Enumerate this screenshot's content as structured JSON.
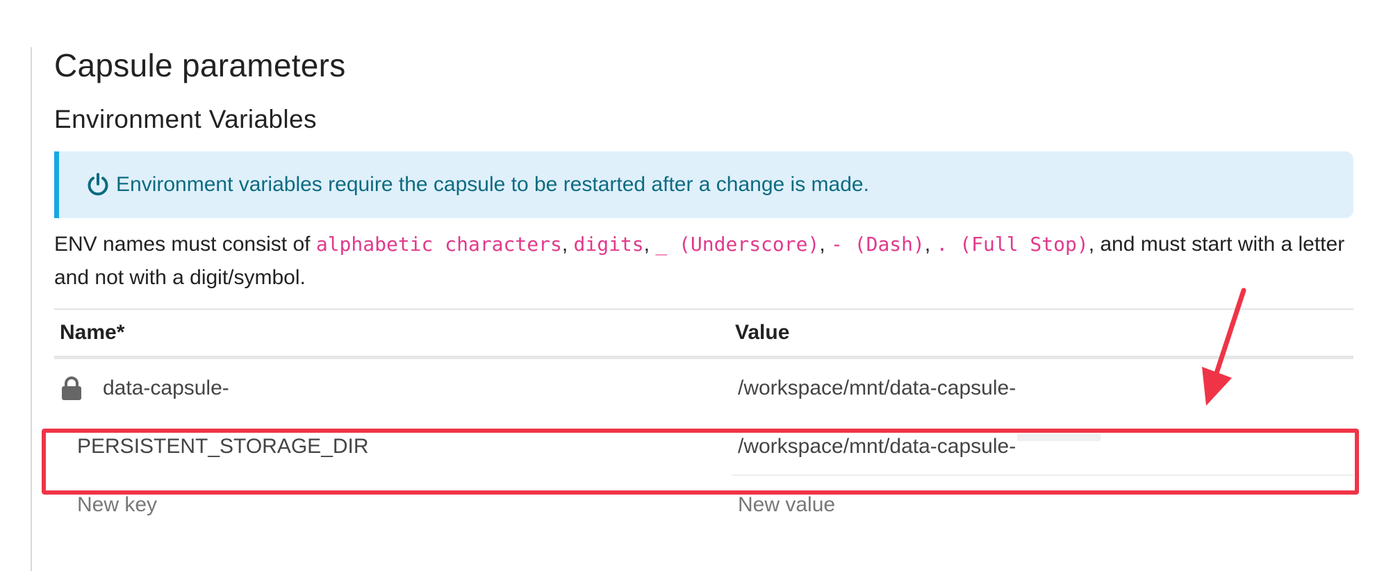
{
  "page": {
    "title": "Capsule parameters"
  },
  "env": {
    "section_title": "Environment Variables",
    "notice": {
      "icon": "power-icon",
      "text": "Environment variables require the capsule to be restarted after a change is made."
    },
    "rules": {
      "prefix": "ENV names must consist of ",
      "codes": [
        "alphabetic characters",
        "digits",
        "_ (Underscore)",
        "- (Dash)",
        ". (Full Stop)"
      ],
      "separator": ", ",
      "suffix": ", and must start with a letter and not with a digit/symbol."
    },
    "table": {
      "headers": {
        "name": "Name*",
        "value": "Value"
      },
      "rows": [
        {
          "name": "data-capsule-",
          "value": "/workspace/mnt/data-capsule-",
          "locked": true,
          "lock_icon": "lock-icon"
        },
        {
          "name": "PERSISTENT_STORAGE_DIR",
          "value": "/workspace/mnt/data-capsule-",
          "locked": false
        }
      ],
      "new_row": {
        "name_placeholder": "New key",
        "value_placeholder": "New value"
      }
    }
  },
  "annotation": {
    "highlight_color": "#ef3447",
    "arrow_color": "#ef3447"
  }
}
